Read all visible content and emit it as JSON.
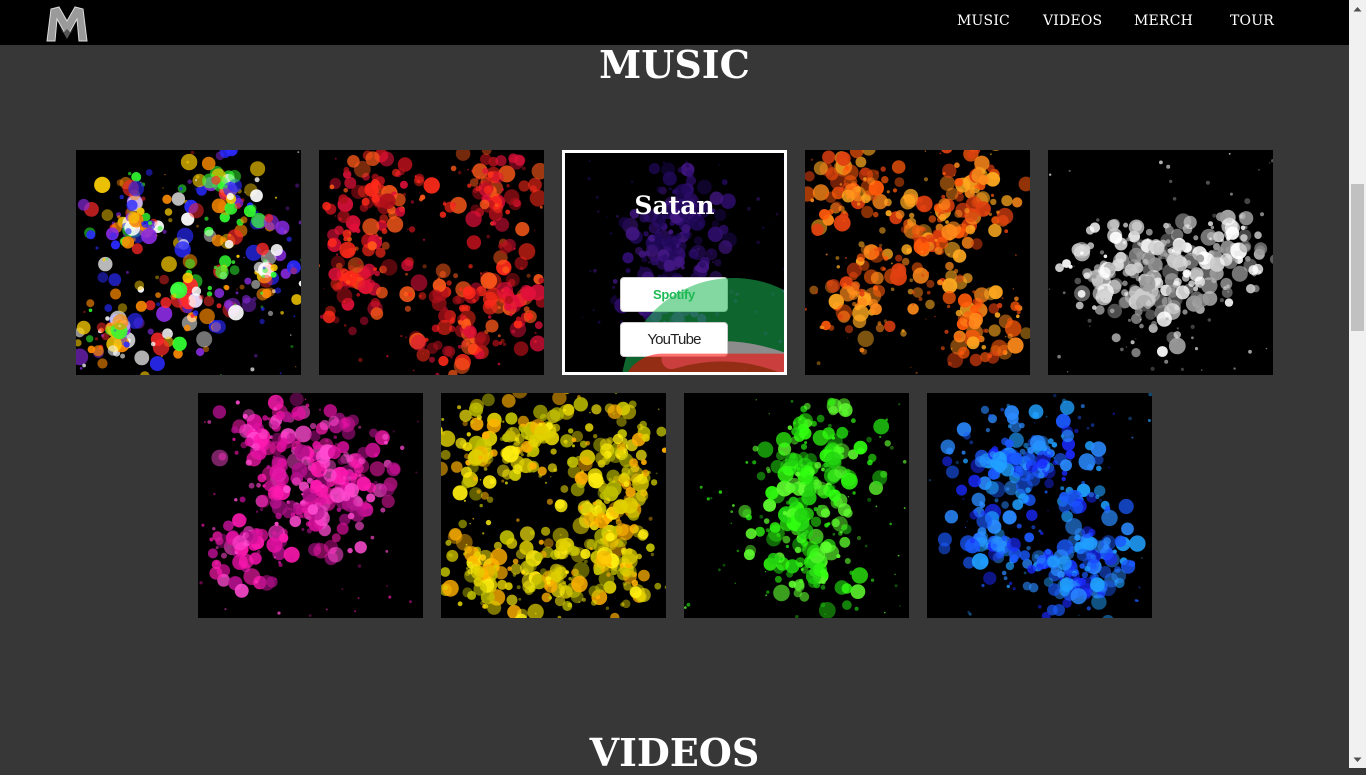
{
  "navbar": {
    "logo_icon": "band-m-logo",
    "links": [
      "MUSIC",
      "VIDEOS",
      "MERCH",
      "TOUR"
    ]
  },
  "music": {
    "heading": "MUSIC",
    "albums": [
      {
        "icon": "paint-splatter-multicolor",
        "colors": [
          "#2a2aff",
          "#ff2a2a",
          "#ffd000",
          "#33ff33",
          "#ffffff",
          "#8a2be2",
          "#ff8c00"
        ]
      },
      {
        "icon": "paint-splatter-red",
        "colors": [
          "#ff2a1a",
          "#e0103a",
          "#ff5a1a",
          "#b0101a"
        ]
      },
      {
        "icon": "paint-splatter-purple",
        "title": "Satan",
        "colors": [
          "#5a1ad0",
          "#7a2af0",
          "#3a10a0"
        ],
        "spotify_label": "Spotify",
        "youtube_label": "YouTube"
      },
      {
        "icon": "paint-splatter-orange",
        "colors": [
          "#ff5a0a",
          "#ff8a1a",
          "#e04010",
          "#ffaa20"
        ]
      },
      {
        "icon": "paint-splatter-white",
        "colors": [
          "#ffffff",
          "#cccccc",
          "#999999"
        ]
      },
      {
        "icon": "paint-splatter-magenta",
        "colors": [
          "#ff1ab0",
          "#e010a0",
          "#b0108a",
          "#ff4ad0"
        ]
      },
      {
        "icon": "paint-splatter-yellow",
        "colors": [
          "#ffee10",
          "#e0d000",
          "#ffb000",
          "#c0c000"
        ]
      },
      {
        "icon": "paint-splatter-green",
        "colors": [
          "#30ff10",
          "#20d010",
          "#60ff30"
        ]
      },
      {
        "icon": "paint-splatter-blue",
        "colors": [
          "#1a5aff",
          "#2a8aff",
          "#1a2aff",
          "#20a0ff"
        ]
      }
    ]
  },
  "videos": {
    "heading": "VIDEOS"
  }
}
